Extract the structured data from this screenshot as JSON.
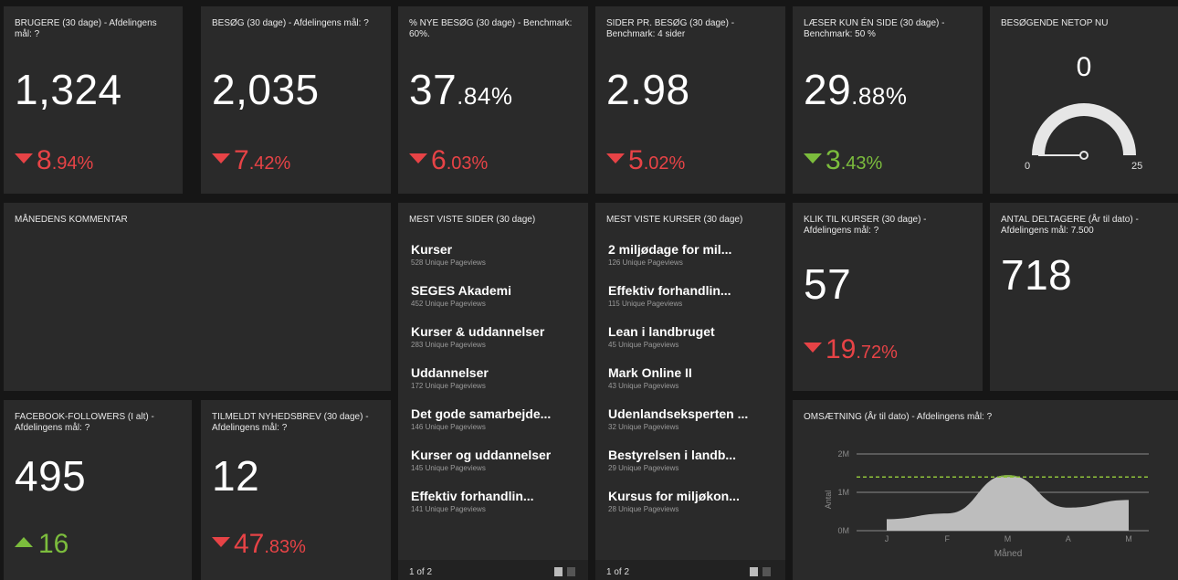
{
  "kpis": [
    {
      "title": "BRUGERE (30 dage) - Afdelingens mål: ?",
      "value_main": "1,324",
      "value_small": "",
      "delta_main": "8",
      "delta_small": ".94%",
      "dir": "down",
      "color": "red"
    },
    {
      "title": "BESØG (30 dage) - Afdelingens mål: ?",
      "value_main": "2,035",
      "value_small": "",
      "delta_main": "7",
      "delta_small": ".42%",
      "dir": "down",
      "color": "red"
    },
    {
      "title": "% NYE BESØG (30 dage) - Benchmark: 60%.",
      "value_main": "37",
      "value_small": ".84%",
      "delta_main": "6",
      "delta_small": ".03%",
      "dir": "down",
      "color": "red"
    },
    {
      "title": "SIDER PR. BESØG (30 dage) - Benchmark: 4 sider",
      "value_main": "2.98",
      "value_small": "",
      "delta_main": "5",
      "delta_small": ".02%",
      "dir": "down",
      "color": "red"
    },
    {
      "title": "LÆSER KUN ÉN SIDE (30 dage) - Benchmark: 50 %",
      "value_main": "29",
      "value_small": ".88%",
      "delta_main": "3",
      "delta_small": ".43%",
      "dir": "down",
      "color": "green"
    }
  ],
  "gauge": {
    "title": "BESØGENDE NETOP NU",
    "value": "0",
    "min": "0",
    "max": "25",
    "level": 0
  },
  "comment": {
    "title": "MÅNEDENS KOMMENTAR"
  },
  "pages": {
    "title": "MEST VISTE SIDER (30 dage)",
    "items": [
      {
        "name": "Kurser",
        "sub": "528 Unique Pageviews"
      },
      {
        "name": "SEGES Akademi",
        "sub": "452 Unique Pageviews"
      },
      {
        "name": "Kurser & uddannelser",
        "sub": "283 Unique Pageviews"
      },
      {
        "name": "Uddannelser",
        "sub": "172 Unique Pageviews"
      },
      {
        "name": "Det gode samarbejde...",
        "sub": "146 Unique Pageviews"
      },
      {
        "name": "Kurser og uddannelser",
        "sub": "145 Unique Pageviews"
      },
      {
        "name": "Effektiv forhandlin...",
        "sub": "141 Unique Pageviews"
      }
    ],
    "pager": "1 of 2"
  },
  "courses": {
    "title": "MEST VISTE KURSER (30 dage)",
    "items": [
      {
        "name": "2 miljødage for mil...",
        "sub": "126 Unique Pageviews"
      },
      {
        "name": "Effektiv forhandlin...",
        "sub": "115 Unique Pageviews"
      },
      {
        "name": "Lean i landbruget",
        "sub": "45 Unique Pageviews"
      },
      {
        "name": "Mark Online II",
        "sub": "43 Unique Pageviews"
      },
      {
        "name": "Udenlandseksperten ...",
        "sub": "32 Unique Pageviews"
      },
      {
        "name": "Bestyrelsen i landb...",
        "sub": "29 Unique Pageviews"
      },
      {
        "name": "Kursus for miljøkon...",
        "sub": "28 Unique Pageviews"
      }
    ],
    "pager": "1 of 2"
  },
  "klik": {
    "title": "KLIK TIL KURSER (30 dage) - Afdelingens mål: ?",
    "value": "57",
    "delta_main": "19",
    "delta_small": ".72%"
  },
  "deltagere": {
    "title": "ANTAL DELTAGERE (År til dato) - Afdelingens mål: 7.500",
    "value": "718"
  },
  "facebook": {
    "title": "FACEBOOK-FOLLOWERS (I alt) - Afdelingens mål: ?",
    "value": "495",
    "delta": "16"
  },
  "nyhedsbrev": {
    "title": "TILMELDT NYHEDSBREV (30 dage) - Afdelingens mål: ?",
    "value": "12",
    "delta_main": "47",
    "delta_small": ".83%"
  },
  "colors": {
    "red": "#e74346",
    "green": "#7cbd3d",
    "tile": "#2a2a2a",
    "bg": "#161616",
    "area": "#bdbdbd",
    "target": "#8fc33a"
  },
  "chart_data": {
    "type": "area",
    "title": "OMSÆTNING (År til dato) - Afdelingens mål: ?",
    "xlabel": "Måned",
    "ylabel": "Antal",
    "categories": [
      "J",
      "F",
      "M",
      "A",
      "M"
    ],
    "yticks": [
      "0M",
      "1M",
      "2M"
    ],
    "ylim": [
      0,
      2000000
    ],
    "values": [
      300000,
      450000,
      1450000,
      600000,
      800000
    ],
    "target": 1400000,
    "grid": true,
    "legend": "none"
  }
}
